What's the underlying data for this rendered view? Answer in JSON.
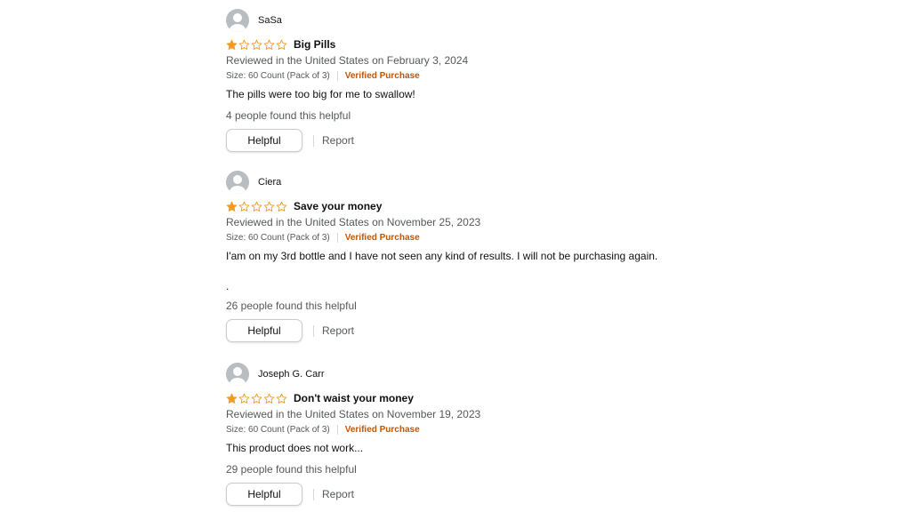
{
  "colors": {
    "star_filled": "#f29a1c",
    "star_empty_outline": "#f29a1c",
    "verified": "#c45500",
    "meta": "#565959"
  },
  "reviews": [
    {
      "reviewer": "SaSa",
      "rating": 1,
      "max_rating": 5,
      "title": "Big Pills",
      "date": "Reviewed in the United States on February 3, 2024",
      "size": "Size: 60 Count (Pack of 3)",
      "verified": "Verified Purchase",
      "body": "The pills were too big for me to swallow!",
      "helpful_count": "4 people found this helpful",
      "helpful_label": "Helpful",
      "report_label": "Report"
    },
    {
      "reviewer": "Ciera",
      "rating": 1,
      "max_rating": 5,
      "title": "Save your money",
      "date": "Reviewed in the United States on November 25, 2023",
      "size": "Size: 60 Count (Pack of 3)",
      "verified": "Verified Purchase",
      "body": "I'am on my 3rd bottle and I have not seen any kind of results. I will not be purchasing again.",
      "extra_line": ".",
      "helpful_count": "26 people found this helpful",
      "helpful_label": "Helpful",
      "report_label": "Report"
    },
    {
      "reviewer": "Joseph G. Carr",
      "rating": 1,
      "max_rating": 5,
      "title": "Don't waist your money",
      "date": "Reviewed in the United States on November 19, 2023",
      "size": "Size: 60 Count (Pack of 3)",
      "verified": "Verified Purchase",
      "body": "This product does not work...",
      "helpful_count": "29 people found this helpful",
      "helpful_label": "Helpful",
      "report_label": "Report"
    }
  ]
}
